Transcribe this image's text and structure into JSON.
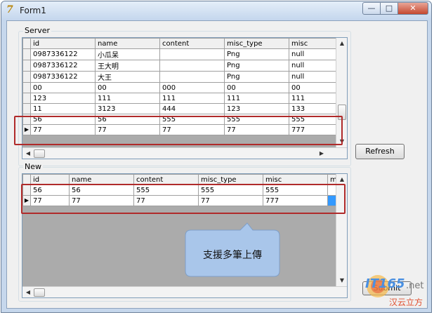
{
  "window": {
    "title": "Form1",
    "minimize_label": "—",
    "maximize_label": "□",
    "close_label": "✕"
  },
  "server_group": {
    "label": "Server",
    "columns": [
      "id",
      "name",
      "content",
      "misc_type",
      "misc"
    ],
    "rows": [
      [
        "0987336122",
        "小瓜呆",
        "",
        "Png",
        "null"
      ],
      [
        "0987336122",
        "王大明",
        "",
        "Png",
        "null"
      ],
      [
        "0987336122",
        "大王",
        "",
        "Png",
        "null"
      ],
      [
        "00",
        "00",
        "000",
        "00",
        "00"
      ],
      [
        "123",
        "111",
        "111",
        "111",
        "111"
      ],
      [
        "11",
        "3123",
        "444",
        "123",
        "133"
      ],
      [
        "56",
        "56",
        "555",
        "555",
        "555"
      ],
      [
        "77",
        "77",
        "77",
        "77",
        "777"
      ]
    ],
    "current_row_marker": "▶"
  },
  "new_group": {
    "label": "New",
    "columns": [
      "id",
      "name",
      "content",
      "misc_type",
      "misc",
      "m"
    ],
    "rows": [
      [
        "56",
        "56",
        "555",
        "555",
        "555",
        ""
      ],
      [
        "77",
        "77",
        "77",
        "77",
        "777",
        ""
      ]
    ],
    "current_row_marker": "▶"
  },
  "buttons": {
    "refresh": "Refresh",
    "submit": "Submit"
  },
  "callout": {
    "text": "支援多筆上傳"
  },
  "watermark": {
    "brand": "IT165",
    "tld": ".net",
    "subtitle": "汉云立方"
  },
  "colors": {
    "highlight": "#b02a2a",
    "callout": "#a9c6ea",
    "selected_cell": "#3399ff"
  }
}
